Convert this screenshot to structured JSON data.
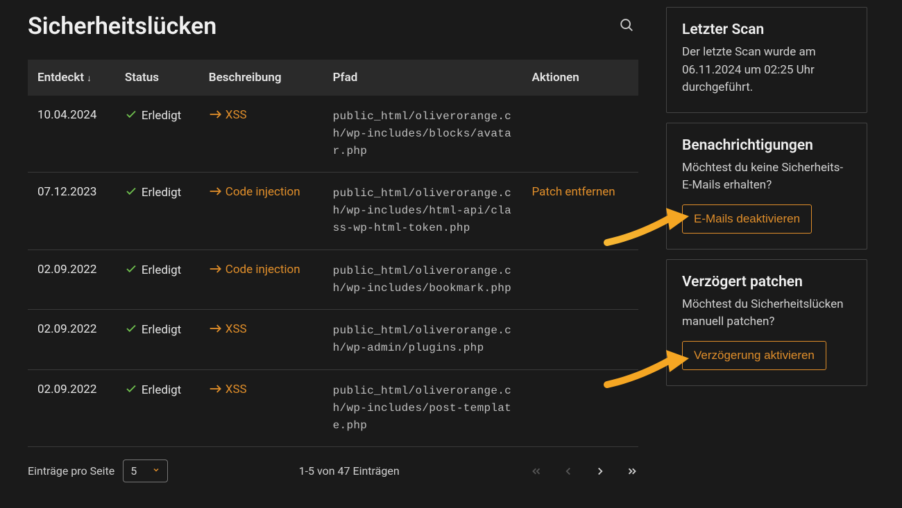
{
  "page": {
    "title": "Sicherheitslücken"
  },
  "table": {
    "headers": {
      "discovered": "Entdeckt",
      "status": "Status",
      "description": "Beschreibung",
      "path": "Pfad",
      "actions": "Aktionen"
    },
    "rows": [
      {
        "date": "10.04.2024",
        "status": "Erledigt",
        "desc": "XSS",
        "path": "public_html/oliverorange.ch/wp-includes/blocks/avatar.php",
        "action": ""
      },
      {
        "date": "07.12.2023",
        "status": "Erledigt",
        "desc": "Code injection",
        "path": "public_html/oliverorange.ch/wp-includes/html-api/class-wp-html-token.php",
        "action": "Patch entfernen"
      },
      {
        "date": "02.09.2022",
        "status": "Erledigt",
        "desc": "Code injection",
        "path": "public_html/oliverorange.ch/wp-includes/bookmark.php",
        "action": ""
      },
      {
        "date": "02.09.2022",
        "status": "Erledigt",
        "desc": "XSS",
        "path": "public_html/oliverorange.ch/wp-admin/plugins.php",
        "action": ""
      },
      {
        "date": "02.09.2022",
        "status": "Erledigt",
        "desc": "XSS",
        "path": "public_html/oliverorange.ch/wp-includes/post-template.php",
        "action": ""
      }
    ]
  },
  "footer": {
    "per_page_label": "Einträge pro Seite",
    "per_page_value": "5",
    "range_text": "1-5 von 47 Einträgen"
  },
  "sidebar": {
    "last_scan": {
      "title": "Letzter Scan",
      "text": "Der letzte Scan wurde am 06.11.2024 um 02:25 Uhr durchgeführt."
    },
    "notifications": {
      "title": "Benachrichtigungen",
      "text": "Möchtest du keine Sicherheits-E-Mails erhalten?",
      "button": "E-Mails deaktivieren"
    },
    "delayed": {
      "title": "Verzögert patchen",
      "text": "Möchtest du Sicherheitslücken manuell patchen?",
      "button": "Verzögerung aktivieren"
    }
  }
}
